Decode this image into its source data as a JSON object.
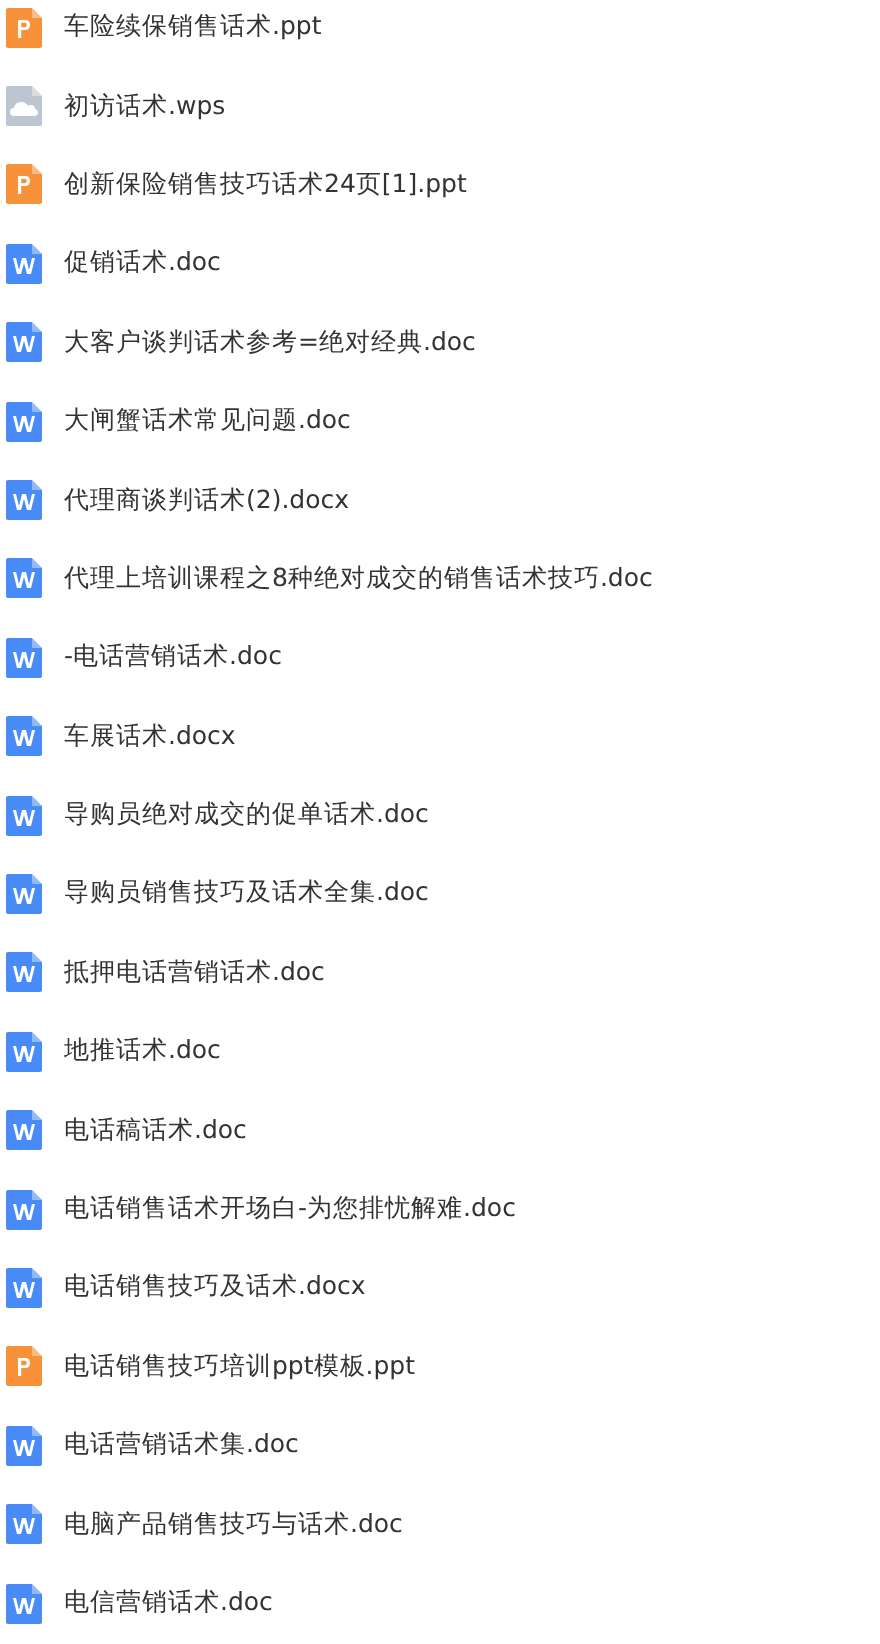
{
  "files": [
    {
      "kind": "ppt",
      "name": "车险续保销售话术.ppt"
    },
    {
      "kind": "wps",
      "name": "初访话术.wps"
    },
    {
      "kind": "ppt",
      "name": "创新保险销售技巧话术24页[1].ppt"
    },
    {
      "kind": "doc",
      "name": "促销话术.doc"
    },
    {
      "kind": "doc",
      "name": "大客户谈判话术参考=绝对经典.doc"
    },
    {
      "kind": "doc",
      "name": "大闸蟹话术常见问题.doc"
    },
    {
      "kind": "doc",
      "name": "代理商谈判话术(2).docx"
    },
    {
      "kind": "doc",
      "name": "代理上培训课程之8种绝对成交的销售话术技巧.doc"
    },
    {
      "kind": "doc",
      "name": "-电话营销话术.doc"
    },
    {
      "kind": "doc",
      "name": "车展话术.docx"
    },
    {
      "kind": "doc",
      "name": "导购员绝对成交的促单话术.doc"
    },
    {
      "kind": "doc",
      "name": "导购员销售技巧及话术全集.doc"
    },
    {
      "kind": "doc",
      "name": "抵押电话营销话术.doc"
    },
    {
      "kind": "doc",
      "name": "地推话术.doc"
    },
    {
      "kind": "doc",
      "name": "电话稿话术.doc"
    },
    {
      "kind": "doc",
      "name": "电话销售话术开场白-为您排忧解难.doc"
    },
    {
      "kind": "doc",
      "name": "电话销售技巧及话术.docx"
    },
    {
      "kind": "ppt",
      "name": "电话销售技巧培训ppt模板.ppt"
    },
    {
      "kind": "doc",
      "name": "电话营销话术集.doc"
    },
    {
      "kind": "doc",
      "name": "电脑产品销售技巧与话术.doc"
    },
    {
      "kind": "doc",
      "name": "电信营销话术.doc"
    }
  ]
}
